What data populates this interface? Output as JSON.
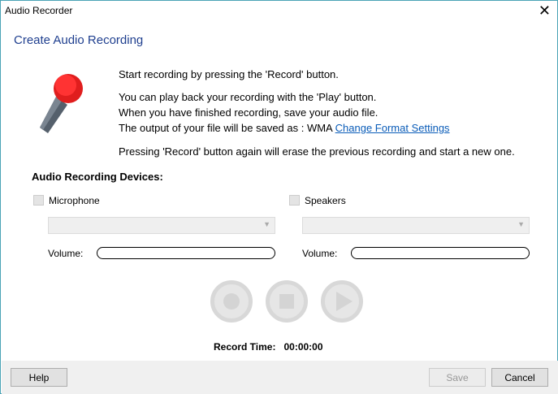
{
  "window": {
    "title": "Audio Recorder",
    "close": "✕"
  },
  "heading": "Create Audio Recording",
  "instructions": {
    "line1": "Start recording by pressing the 'Record' button.",
    "line2": "You can play back your recording with the 'Play' button.",
    "line3": "When you have finished recording, save your audio file.",
    "line4": "The output of your file will be saved as : WMA",
    "link": "Change Format Settings",
    "line5": "Pressing 'Record' button again will erase the previous recording and start a new one."
  },
  "devices": {
    "title": "Audio Recording Devices:",
    "microphone": "Microphone",
    "speakers": "Speakers",
    "volume": "Volume:"
  },
  "record_time": {
    "label": "Record Time:",
    "value": "00:00:00"
  },
  "footer": {
    "help": "Help",
    "save": "Save",
    "cancel": "Cancel"
  }
}
